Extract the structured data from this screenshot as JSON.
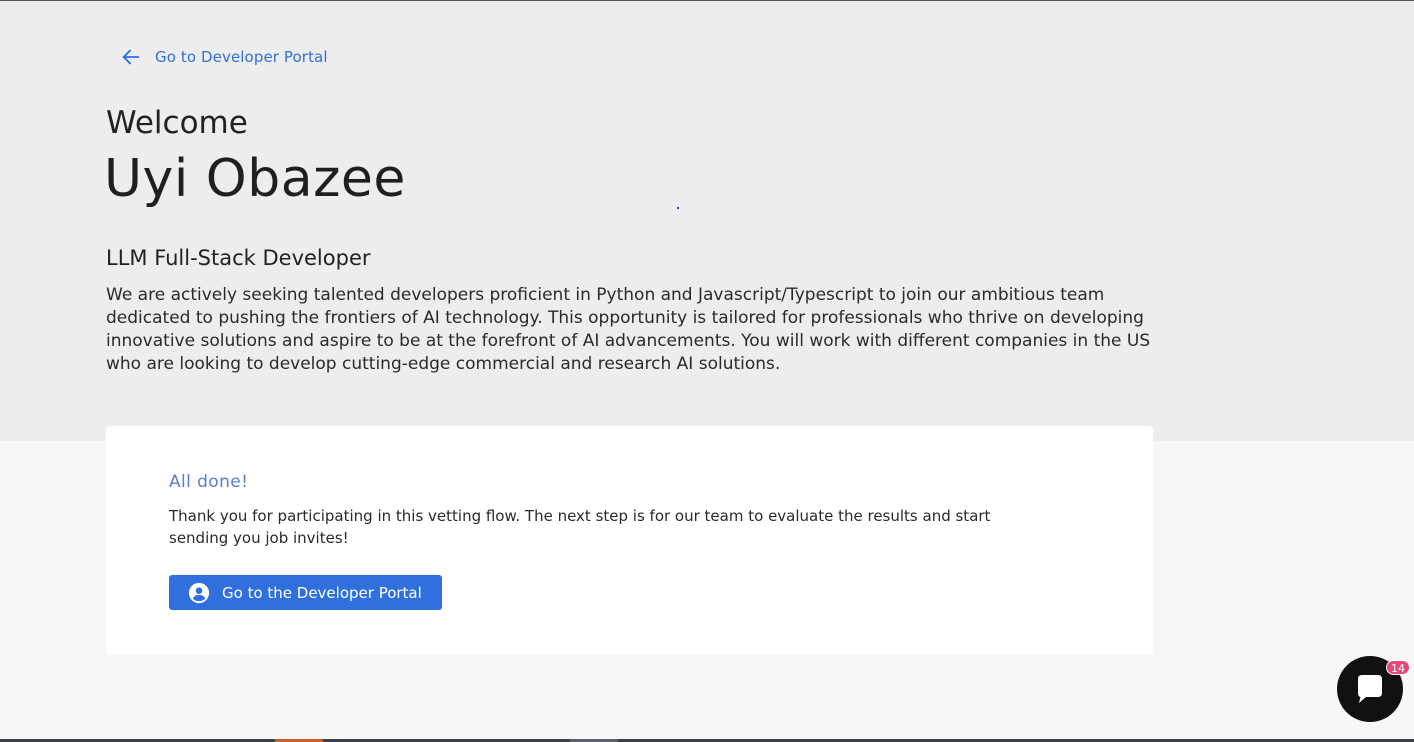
{
  "nav": {
    "back_label": "Go to Developer Portal",
    "back_icon": "arrow-left-icon"
  },
  "hero": {
    "welcome": "Welcome",
    "name": "Uyi Obazee",
    "role": "LLM Full-Stack Developer",
    "description": "We are actively seeking talented developers proficient in Python and Javascript/Typescript to join our ambitious team dedicated to pushing the frontiers of AI technology. This opportunity is tailored for professionals who thrive on developing innovative solutions and aspire to be at the forefront of AI advancements. You will work with different companies in the US who are looking to develop cutting-edge commercial and research AI solutions."
  },
  "card": {
    "title": "All done!",
    "text": "Thank you for participating in this vetting flow. The next step is for our team to evaluate the results and start sending you job invites!",
    "button_label": "Go to the Developer Portal",
    "button_icon": "user-circle-icon"
  },
  "chat": {
    "icon": "chat-bubble-icon",
    "badge_count": "14"
  },
  "colors": {
    "accent": "#2f6fde",
    "hero_bg": "#ededed",
    "page_bg": "#f7f7f7",
    "card_title": "#5b7bd5",
    "badge": "#e9467a",
    "chat_bg": "#111111"
  }
}
